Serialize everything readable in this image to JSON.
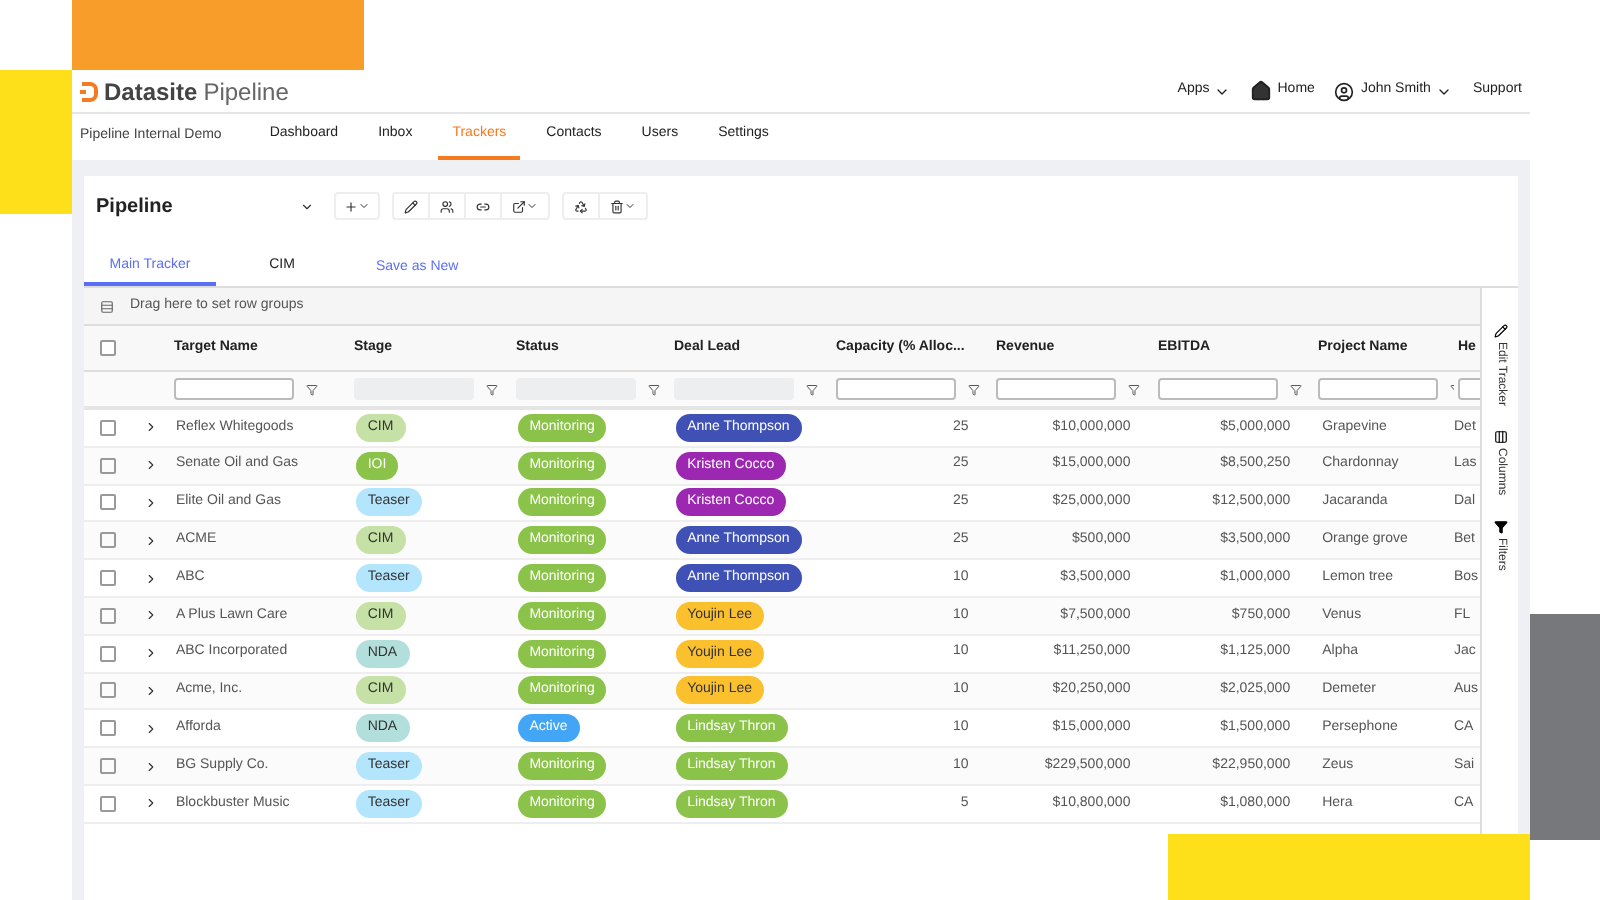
{
  "header": {
    "brand": "Datasite",
    "product": "Pipeline",
    "apps": "Apps",
    "home": "Home",
    "user": "John Smith",
    "support": "Support"
  },
  "nav": {
    "workspace": "Pipeline Internal Demo",
    "tabs": [
      {
        "label": "Dashboard",
        "selected": false
      },
      {
        "label": "Inbox",
        "selected": false
      },
      {
        "label": "Trackers",
        "selected": true
      },
      {
        "label": "Contacts",
        "selected": false
      },
      {
        "label": "Users",
        "selected": false
      },
      {
        "label": "Settings",
        "selected": false
      }
    ]
  },
  "tracker": {
    "title": "Pipeline",
    "tabs": [
      {
        "label": "Main Tracker",
        "selected": true
      },
      {
        "label": "CIM",
        "selected": false
      }
    ],
    "save_as_new": "Save as New",
    "group_bar": "Drag here to set row groups"
  },
  "table": {
    "select_all_checked": false,
    "columns": [
      {
        "label": "Target Name",
        "filter_disabled": false
      },
      {
        "label": "Stage",
        "filter_disabled": true
      },
      {
        "label": "Status",
        "filter_disabled": true
      },
      {
        "label": "Deal Lead",
        "filter_disabled": true
      },
      {
        "label": "Capacity (% Alloc...",
        "filter_disabled": false
      },
      {
        "label": "Revenue",
        "filter_disabled": false
      },
      {
        "label": "EBITDA",
        "filter_disabled": false
      },
      {
        "label": "Project Name",
        "filter_disabled": false
      },
      {
        "label": "He",
        "filter_disabled": false
      }
    ],
    "rows": [
      {
        "checked": false,
        "target": "Reflex Whitegoods",
        "stage": {
          "label": "CIM",
          "color": "#c5e1a5"
        },
        "status": {
          "label": "Monitoring",
          "color": "#8bc34a"
        },
        "lead": {
          "label": "Anne Thompson",
          "color": "#3f51b5"
        },
        "capacity": "25",
        "revenue": "$10,000,000",
        "ebitda": "$5,000,000",
        "project": "Grapevine",
        "column_9": "Det"
      },
      {
        "checked": false,
        "target": "Senate Oil and Gas",
        "stage": {
          "label": "IOI",
          "color": "#8bc34a"
        },
        "status": {
          "label": "Monitoring",
          "color": "#8bc34a"
        },
        "lead": {
          "label": "Kristen Cocco",
          "color": "#9c27b0"
        },
        "capacity": "25",
        "revenue": "$15,000,000",
        "ebitda": "$8,500,250",
        "project": "Chardonnay",
        "column_9": "Las"
      },
      {
        "checked": false,
        "target": "Elite Oil and Gas",
        "stage": {
          "label": "Teaser",
          "color": "#b3e5fc"
        },
        "status": {
          "label": "Monitoring",
          "color": "#8bc34a"
        },
        "lead": {
          "label": "Kristen Cocco",
          "color": "#9c27b0"
        },
        "capacity": "25",
        "revenue": "$25,000,000",
        "ebitda": "$12,500,000",
        "project": "Jacaranda",
        "column_9": "Dal"
      },
      {
        "checked": false,
        "target": "ACME",
        "stage": {
          "label": "CIM",
          "color": "#c5e1a5"
        },
        "status": {
          "label": "Monitoring",
          "color": "#8bc34a"
        },
        "lead": {
          "label": "Anne Thompson",
          "color": "#3f51b5"
        },
        "capacity": "25",
        "revenue": "$500,000",
        "ebitda": "$3,500,000",
        "project": "Orange grove",
        "column_9": "Bet"
      },
      {
        "checked": false,
        "target": "ABC",
        "stage": {
          "label": "Teaser",
          "color": "#b3e5fc"
        },
        "status": {
          "label": "Monitoring",
          "color": "#8bc34a"
        },
        "lead": {
          "label": "Anne Thompson",
          "color": "#3f51b5"
        },
        "capacity": "10",
        "revenue": "$3,500,000",
        "ebitda": "$1,000,000",
        "project": "Lemon tree",
        "column_9": "Bos"
      },
      {
        "checked": false,
        "target": "A Plus Lawn Care",
        "stage": {
          "label": "CIM",
          "color": "#c5e1a5"
        },
        "status": {
          "label": "Monitoring",
          "color": "#8bc34a"
        },
        "lead": {
          "label": "Youjin Lee",
          "color": "#fbc02d"
        },
        "capacity": "10",
        "revenue": "$7,500,000",
        "ebitda": "$750,000",
        "project": "Venus",
        "column_9": "FL"
      },
      {
        "checked": false,
        "target": "ABC Incorporated",
        "stage": {
          "label": "NDA",
          "color": "#b2dfdb"
        },
        "status": {
          "label": "Monitoring",
          "color": "#8bc34a"
        },
        "lead": {
          "label": "Youjin Lee",
          "color": "#fbc02d"
        },
        "capacity": "10",
        "revenue": "$11,250,000",
        "ebitda": "$1,125,000",
        "project": "Alpha",
        "column_9": "Jac"
      },
      {
        "checked": false,
        "target": "Acme, Inc.",
        "stage": {
          "label": "CIM",
          "color": "#c5e1a5"
        },
        "status": {
          "label": "Monitoring",
          "color": "#8bc34a"
        },
        "lead": {
          "label": "Youjin Lee",
          "color": "#fbc02d"
        },
        "capacity": "10",
        "revenue": "$20,250,000",
        "ebitda": "$2,025,000",
        "project": "Demeter",
        "column_9": "Aus"
      },
      {
        "checked": false,
        "target": "Afforda",
        "stage": {
          "label": "NDA",
          "color": "#b2dfdb"
        },
        "status": {
          "label": "Active",
          "color": "#42a5f5"
        },
        "lead": {
          "label": "Lindsay Thron",
          "color": "#8bc34a"
        },
        "capacity": "10",
        "revenue": "$15,000,000",
        "ebitda": "$1,500,000",
        "project": "Persephone",
        "column_9": "CA"
      },
      {
        "checked": false,
        "target": "BG Supply Co.",
        "stage": {
          "label": "Teaser",
          "color": "#b3e5fc"
        },
        "status": {
          "label": "Monitoring",
          "color": "#8bc34a"
        },
        "lead": {
          "label": "Lindsay Thron",
          "color": "#8bc34a"
        },
        "capacity": "10",
        "revenue": "$229,500,000",
        "ebitda": "$22,950,000",
        "project": "Zeus",
        "column_9": "Sai"
      },
      {
        "checked": false,
        "target": "Blockbuster Music",
        "stage": {
          "label": "Teaser",
          "color": "#b3e5fc"
        },
        "status": {
          "label": "Monitoring",
          "color": "#8bc34a"
        },
        "lead": {
          "label": "Lindsay Thron",
          "color": "#8bc34a"
        },
        "capacity": "5",
        "revenue": "$10,800,000",
        "ebitda": "$1,080,000",
        "project": "Hera",
        "column_9": "CA"
      }
    ]
  },
  "side_panel": [
    {
      "label": "Edit Tracker",
      "kind": "edit"
    },
    {
      "label": "Columns",
      "kind": "columns"
    },
    {
      "label": "Filters",
      "kind": "filters"
    }
  ]
}
